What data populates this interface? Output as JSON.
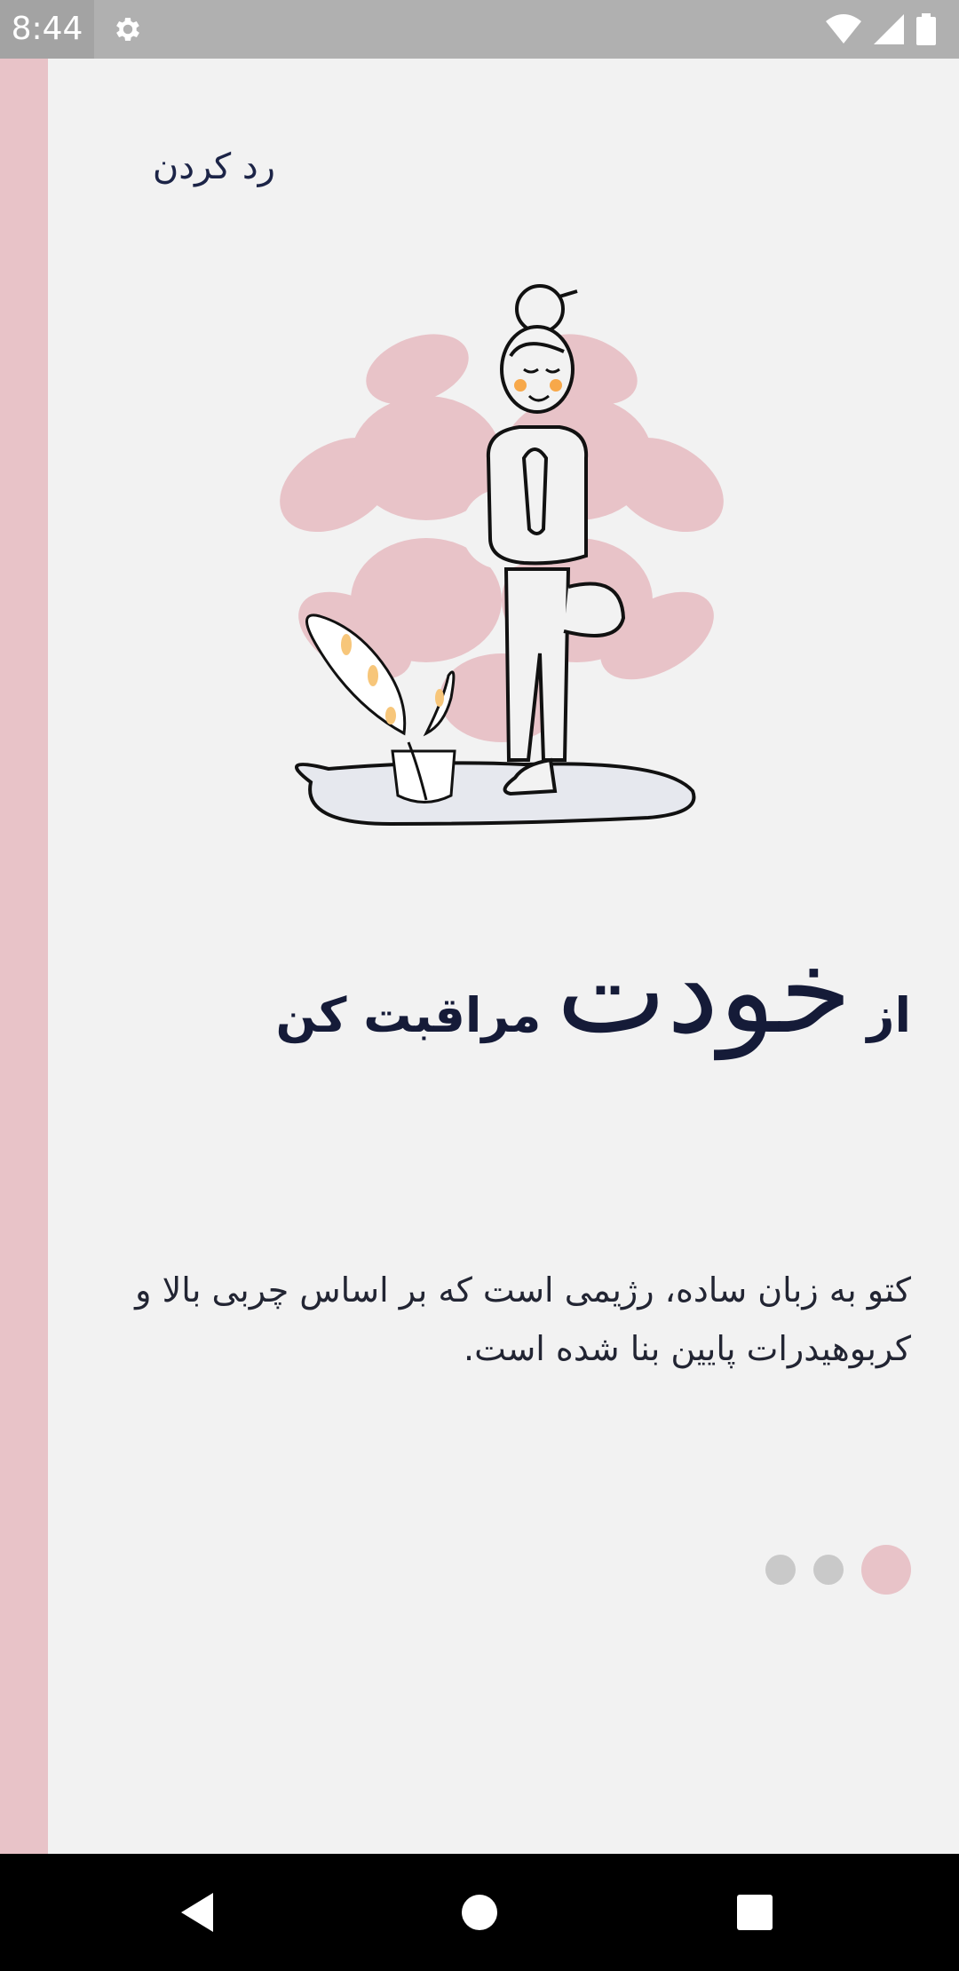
{
  "status_bar": {
    "time": "8:44",
    "icons": [
      "settings-icon",
      "wifi-icon",
      "signal-icon",
      "battery-icon"
    ]
  },
  "onboarding": {
    "skip_label": "رد کردن",
    "headline": {
      "prefix": "از",
      "emphasis": "خودت",
      "suffix": "مراقبت کن"
    },
    "description": "کتو به زبان ساده، رژیمی است که بر اساس چربی بالا و کربوهیدرات پایین بنا شده است.",
    "pager": {
      "pages": 3,
      "active_index": 0
    }
  },
  "colors": {
    "accent": "#e8c3c8",
    "background": "#f2f2f2",
    "text_dark": "#151b38",
    "dot_inactive": "#c9c9c9"
  },
  "nav_bar": {
    "icons": [
      "back-icon",
      "home-icon",
      "recents-icon"
    ]
  }
}
